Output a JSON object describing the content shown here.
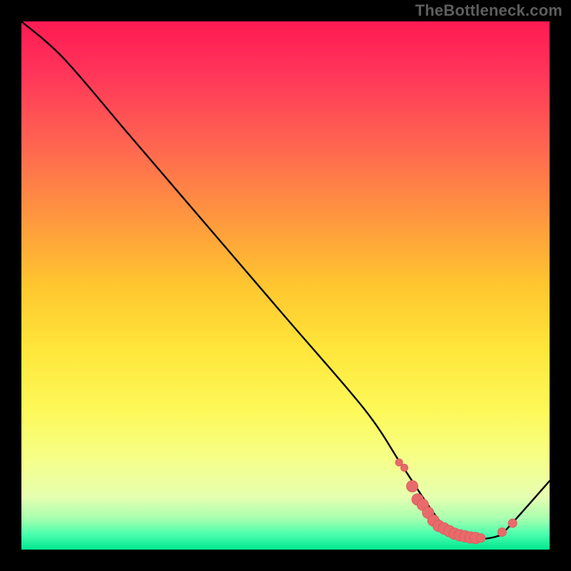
{
  "watermark": "TheBottleneck.com",
  "colors": {
    "frame": "#000000",
    "line": "#000000",
    "marker": "#e96a6a",
    "marker_border": "#d85e5e"
  },
  "chart_data": {
    "type": "line",
    "title": "",
    "xlabel": "",
    "ylabel": "",
    "xlim": [
      0,
      100
    ],
    "ylim": [
      0,
      100
    ],
    "grid": false,
    "legend": false,
    "series": [
      {
        "name": "bottleneck-curve",
        "x": [
          0,
          8,
          20,
          35,
          50,
          65,
          72,
          78,
          82,
          86,
          90,
          92,
          100
        ],
        "y": [
          100,
          93,
          79,
          61.5,
          44,
          26.5,
          16,
          7,
          2.5,
          2,
          2.5,
          4,
          13
        ]
      }
    ],
    "markers": {
      "name": "highlight-points",
      "x": [
        71.5,
        72.5,
        74,
        75,
        76,
        77,
        78,
        79,
        80,
        81,
        82,
        83,
        84,
        85,
        86,
        87,
        91,
        93
      ],
      "y": [
        16.5,
        15.5,
        12,
        9.5,
        8.5,
        7,
        5.5,
        4.5,
        4,
        3.5,
        3,
        2.7,
        2.5,
        2.3,
        2.2,
        2.2,
        3.3,
        5
      ],
      "size": [
        5,
        5,
        8,
        8,
        8,
        8,
        8,
        8,
        8,
        8,
        8,
        8,
        8,
        8,
        8,
        6,
        6,
        6
      ]
    }
  }
}
